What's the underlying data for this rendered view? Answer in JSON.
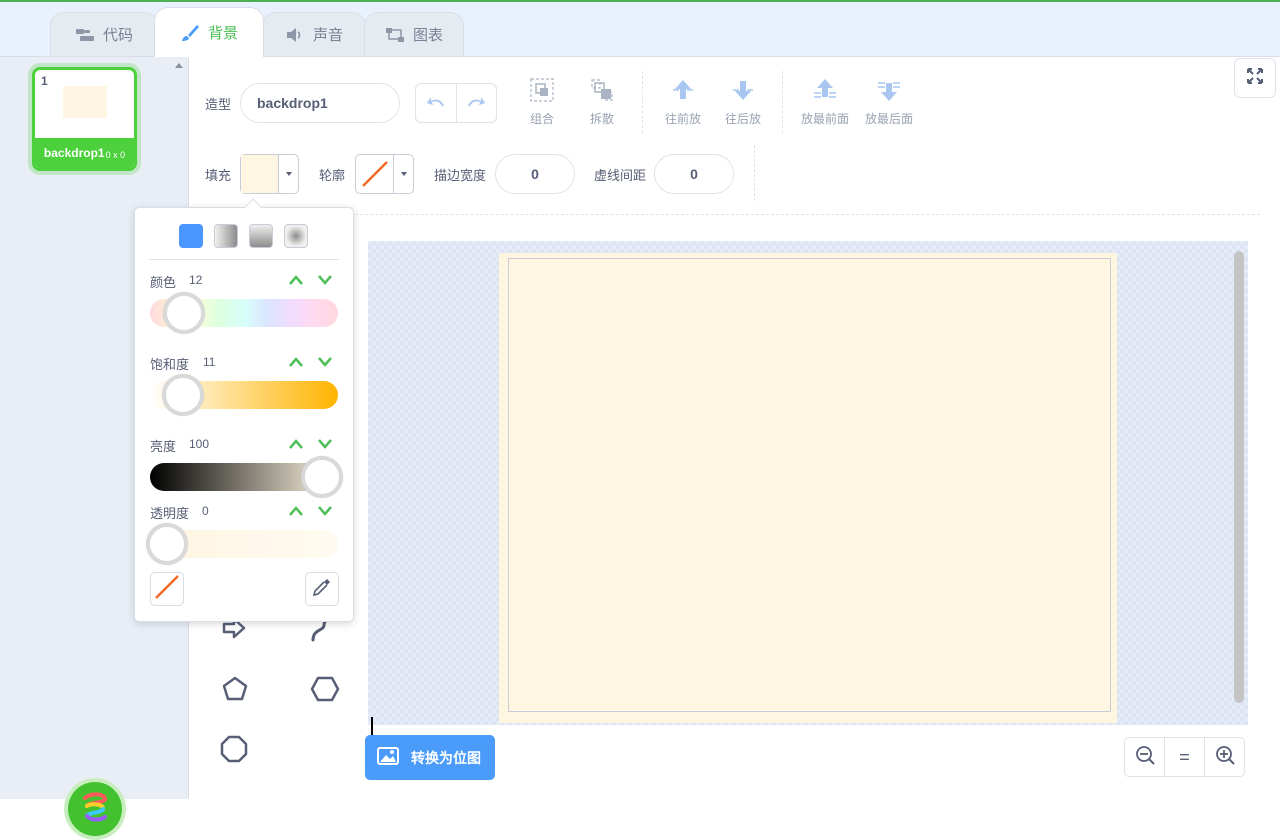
{
  "tabs": [
    {
      "label": "代码",
      "icon": "code-blocks-icon",
      "active": false
    },
    {
      "label": "背景",
      "icon": "paintbrush-icon",
      "active": true
    },
    {
      "label": "声音",
      "icon": "speaker-icon",
      "active": false
    },
    {
      "label": "图表",
      "icon": "diagram-icon",
      "active": false
    }
  ],
  "costumes": [
    {
      "number": "1",
      "name": "backdrop1",
      "size": "0 x 0",
      "selected": true
    }
  ],
  "toolbar": {
    "costume_label": "造型",
    "costume_name": "backdrop1",
    "group": "组合",
    "ungroup": "拆散",
    "forward": "往前放",
    "backward": "往后放",
    "front": "放最前面",
    "back": "放最后面"
  },
  "fill_row": {
    "fill_label": "填充",
    "outline_label": "轮廓",
    "stroke_width_label": "描边宽度",
    "stroke_width": "0",
    "dash_label": "虚线间距",
    "dash_gap": "0"
  },
  "color_picker": {
    "hue_label": "颜色",
    "hue": "12",
    "saturation_label": "饱和度",
    "saturation": "11",
    "brightness_label": "亮度",
    "brightness": "100",
    "transparency_label": "透明度",
    "transparency": "0",
    "selected_fill_mode": "solid"
  },
  "colors": {
    "accent_green": "#4cd13d",
    "fill_color": "#fff6e2",
    "convert_blue": "#4a9bfa",
    "outline_none": "#f26a29"
  },
  "bottom": {
    "convert_label": "转换为位图",
    "zoom_reset": "="
  }
}
